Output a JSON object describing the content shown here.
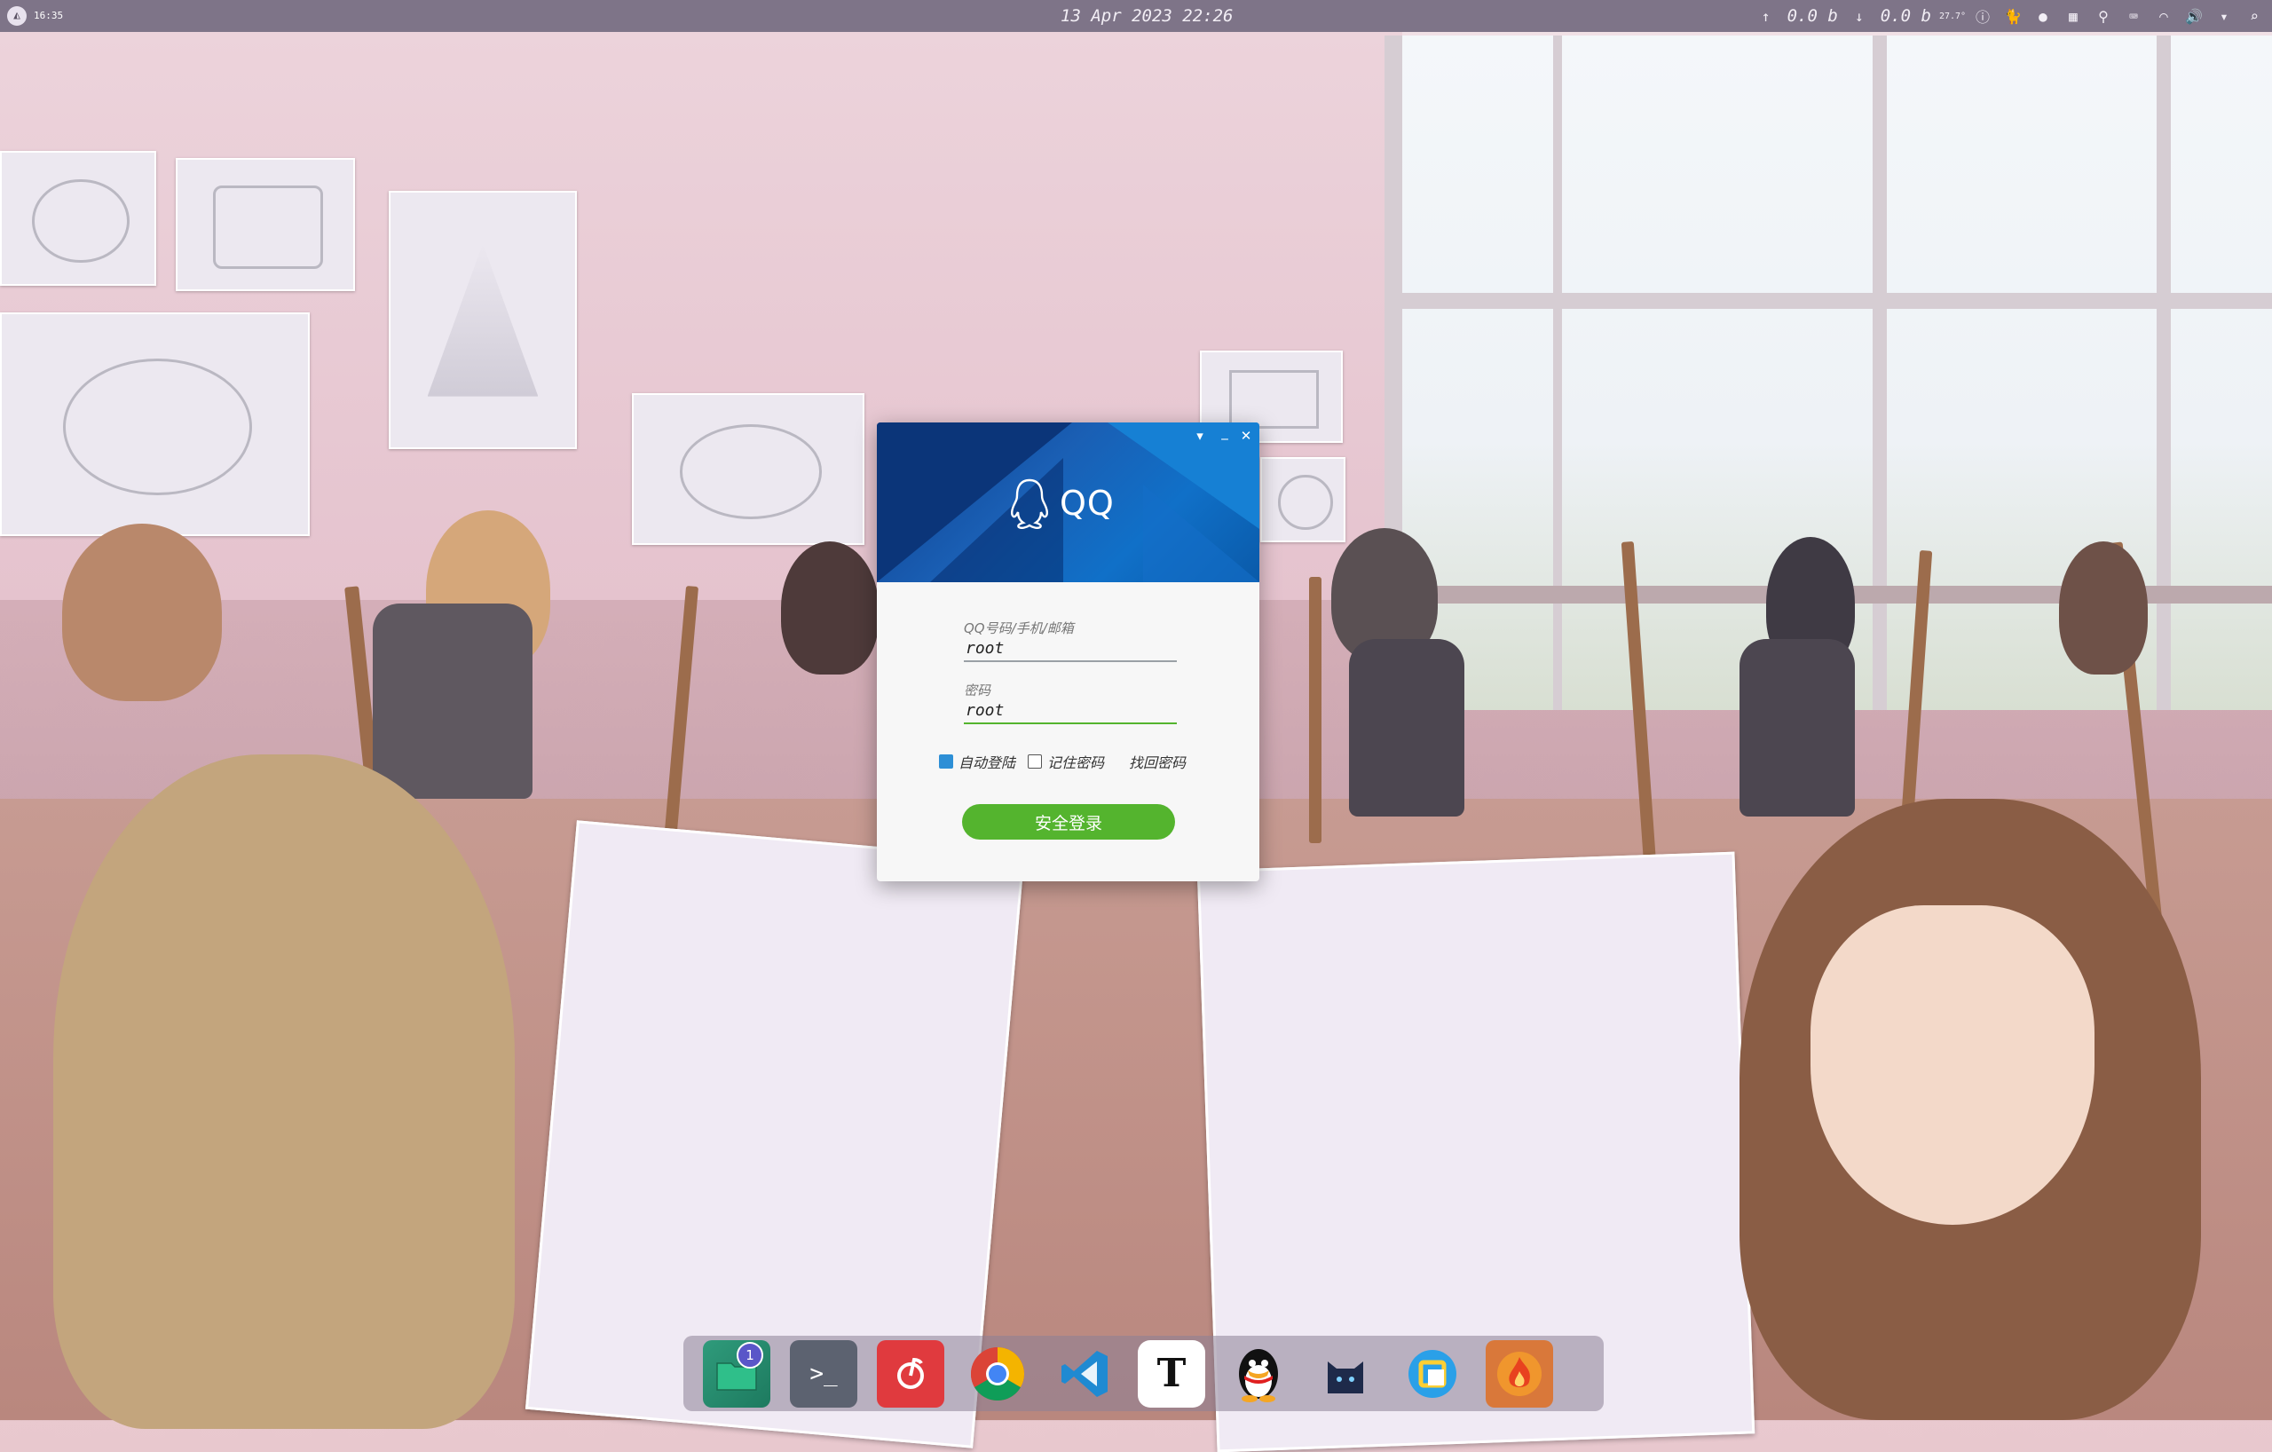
{
  "topbar": {
    "logo_glyph": "◭",
    "workspace": "16:35",
    "datetime": "13 Apr 2023 22:26",
    "upload_arrow": "↑",
    "net_up": "0.0 b",
    "down_arrow": "↓",
    "net_down": "0.0 b",
    "temp": "27.7°"
  },
  "qq_login": {
    "brand": "QQ",
    "window_controls": {
      "menu": "▾",
      "minimize": "_",
      "close": "✕"
    },
    "account_label": "QQ号码/手机/邮箱",
    "account_value": "root",
    "password_label": "密码",
    "password_value": "root",
    "auto_login_label": "自动登陆",
    "auto_login_checked": true,
    "remember_label": "记住密码",
    "remember_checked": false,
    "recover_label": "找回密码",
    "login_button": "安全登录",
    "accent_color": "#54b42e",
    "banner_color": "#1a5fb4"
  },
  "dock": {
    "apps": [
      {
        "name": "file-manager",
        "badge": "1"
      },
      {
        "name": "terminal",
        "glyph": ">_"
      },
      {
        "name": "netease-music"
      },
      {
        "name": "chrome"
      },
      {
        "name": "vscode"
      },
      {
        "name": "typora",
        "glyph": "T"
      },
      {
        "name": "qq"
      },
      {
        "name": "cat-app"
      },
      {
        "name": "window-app"
      },
      {
        "name": "firewall-app"
      }
    ]
  }
}
